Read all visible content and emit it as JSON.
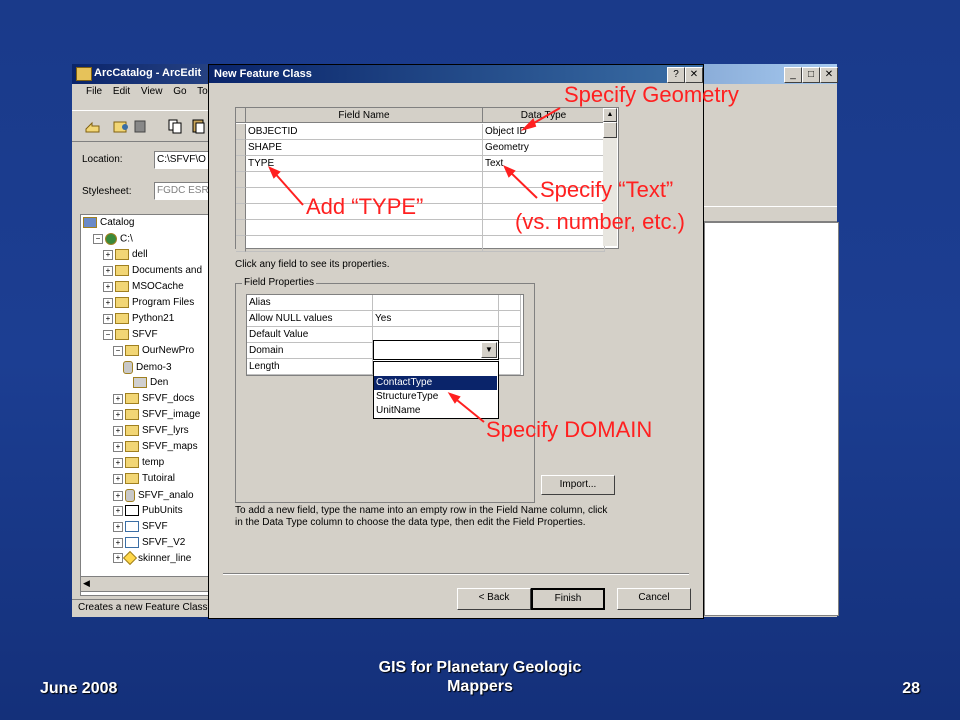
{
  "arccatalog": {
    "title": "ArcCatalog - ArcEdit",
    "menu": [
      "File",
      "Edit",
      "View",
      "Go",
      "Tools"
    ],
    "location_label": "Location:",
    "location_value": "C:\\SFVF\\O",
    "stylesheet_label": "Stylesheet:",
    "stylesheet_value": "FGDC ESRI",
    "status": "Creates a new Feature Class",
    "tree": [
      {
        "label": "Catalog",
        "level": 0,
        "icon": "catalog-icon"
      },
      {
        "label": "C:\\",
        "level": 1,
        "icon": "drive-icon"
      },
      {
        "label": "dell",
        "level": 2,
        "icon": "folder-icon"
      },
      {
        "label": "Documents and",
        "level": 2,
        "icon": "folder-icon"
      },
      {
        "label": "MSOCache",
        "level": 2,
        "icon": "folder-icon"
      },
      {
        "label": "Program Files",
        "level": 2,
        "icon": "folder-icon"
      },
      {
        "label": "Python21",
        "level": 2,
        "icon": "folder-icon"
      },
      {
        "label": "SFVF",
        "level": 2,
        "icon": "folder-icon"
      },
      {
        "label": "OurNewPro",
        "level": 3,
        "icon": "folder-icon"
      },
      {
        "label": "Demo-3",
        "level": 4,
        "icon": "geodatabase-icon"
      },
      {
        "label": "Den",
        "level": 5,
        "icon": "dataset-icon"
      },
      {
        "label": "SFVF_docs",
        "level": 3,
        "icon": "folder-icon"
      },
      {
        "label": "SFVF_image",
        "level": 3,
        "icon": "folder-icon"
      },
      {
        "label": "SFVF_lyrs",
        "level": 3,
        "icon": "folder-icon"
      },
      {
        "label": "SFVF_maps",
        "level": 3,
        "icon": "folder-icon"
      },
      {
        "label": "temp",
        "level": 3,
        "icon": "folder-icon"
      },
      {
        "label": "Tutoiral",
        "level": 3,
        "icon": "folder-icon"
      },
      {
        "label": "SFVF_analo",
        "level": 3,
        "icon": "geodatabase-icon"
      },
      {
        "label": "PubUnits",
        "level": 3,
        "icon": "table-icon"
      },
      {
        "label": "SFVF",
        "level": 3,
        "icon": "map-icon"
      },
      {
        "label": "SFVF_V2",
        "level": 3,
        "icon": "map-icon"
      },
      {
        "label": "skinner_line",
        "level": 3,
        "icon": "layer-icon"
      }
    ]
  },
  "dialog": {
    "title": "New Feature Class",
    "help_button": "?",
    "close_button": "✕",
    "grid_headers": {
      "field_name": "Field Name",
      "data_type": "Data Type"
    },
    "rows": [
      {
        "name": "OBJECTID",
        "type": "Object ID"
      },
      {
        "name": "SHAPE",
        "type": "Geometry"
      },
      {
        "name": "TYPE",
        "type": "Text"
      }
    ],
    "click_hint": "Click any field to see its properties.",
    "field_properties_label": "Field Properties",
    "properties": [
      {
        "name": "Alias",
        "value": ""
      },
      {
        "name": "Allow NULL values",
        "value": "Yes"
      },
      {
        "name": "Default Value",
        "value": ""
      },
      {
        "name": "Domain",
        "value": ""
      },
      {
        "name": "Length",
        "value": ""
      }
    ],
    "domain_options": [
      "ContactType",
      "StructureType",
      "UnitName"
    ],
    "domain_selected": "ContactType",
    "import_button": "Import...",
    "instructions": "To add a new field, type the name into an empty row in the Field Name column, click in the Data Type column to choose the data type, then edit the Field Properties.",
    "back_button": "< Back",
    "finish_button": "Finish",
    "cancel_button": "Cancel"
  },
  "annotations": {
    "geometry": "Specify Geometry",
    "text_line1": "Specify “Text”",
    "text_line2": "(vs. number, etc.)",
    "type": "Add “TYPE”",
    "domain": "Specify DOMAIN",
    "color": "#ff2020"
  },
  "footer": {
    "date": "June 2008",
    "title": "GIS for Planetary Geologic Mappers",
    "page": "28"
  }
}
